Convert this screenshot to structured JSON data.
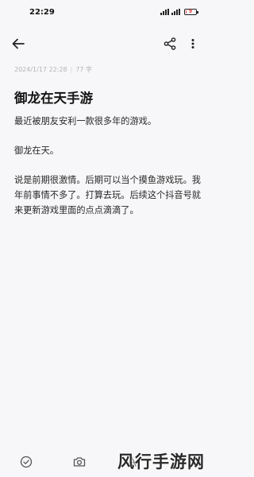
{
  "status_bar": {
    "time": "22:29",
    "battery_level": "9",
    "battery_color": "#e53935",
    "icons": [
      "signal-icon",
      "signal-icon",
      "battery-icon"
    ]
  },
  "app_bar": {
    "icons": [
      "back-arrow-icon",
      "share-icon",
      "more-vert-icon"
    ]
  },
  "note": {
    "date": "2024/1/17 22:28",
    "separator": "|",
    "word_count": "77 字",
    "title": "御龙在天手游",
    "paragraphs": [
      "最近被朋友安利一款很多年的游戏。",
      "御龙在天。",
      "说是前期很激情。后期可以当个摸鱼游戏玩。我年前事情不多了。打算去玩。后续这个抖音号就来更新游戏里面的点点滴滴了。"
    ]
  },
  "bottom_bar": {
    "icons": [
      "checkbox-circle-icon",
      "camera-icon",
      "text-style-icon"
    ]
  },
  "watermark": "风行手游网"
}
